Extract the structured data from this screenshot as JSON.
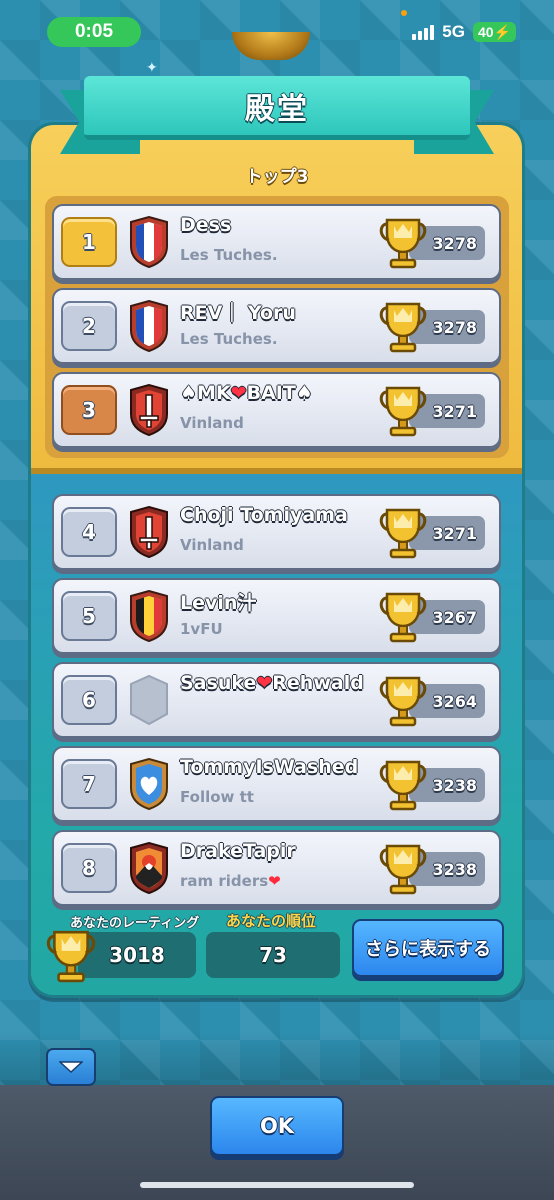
{
  "status_bar": {
    "time": "0:05",
    "network": "5G",
    "battery": "40"
  },
  "header": {
    "title": "殿堂",
    "subtitle": "トップ3"
  },
  "players": [
    {
      "rank": "1",
      "name": "Dess",
      "clan": "Les Tuches.",
      "trophies": "3278",
      "badge": "french-flag-badge-icon",
      "rank_style": "gold"
    },
    {
      "rank": "2",
      "name": "REV｜ Yoru",
      "clan": "Les Tuches.",
      "trophies": "3278",
      "badge": "french-flag-badge-icon",
      "rank_style": "silver"
    },
    {
      "rank": "3",
      "name_parts": [
        "♠MK",
        "❤",
        "BAIT♠"
      ],
      "clan": "Vinland",
      "trophies": "3271",
      "badge": "sword-badge-icon",
      "rank_style": "bronze"
    },
    {
      "rank": "4",
      "name": "Choji Tomiyama",
      "clan": "Vinland",
      "trophies": "3271",
      "badge": "sword-badge-icon",
      "rank_style": "plain"
    },
    {
      "rank": "5",
      "name": "Levin汁",
      "clan": "1vFU",
      "trophies": "3267",
      "badge": "belgian-flag-badge-icon",
      "rank_style": "plain"
    },
    {
      "rank": "6",
      "name_parts": [
        "Sasuke",
        "❤",
        "Rehwald"
      ],
      "clan": "",
      "trophies": "3264",
      "badge": "empty-badge-icon",
      "rank_style": "plain"
    },
    {
      "rank": "7",
      "name": "TommyIsWashed",
      "clan": "Follow tt",
      "trophies": "3238",
      "badge": "heart-badge-icon",
      "rank_style": "plain"
    },
    {
      "rank": "8",
      "name": "DrakeTapir",
      "clan_parts": [
        "ram riders",
        "❤"
      ],
      "trophies": "3238",
      "badge": "mountain-badge-icon",
      "rank_style": "plain"
    }
  ],
  "footer": {
    "your_rating_label": "あなたのレーティング",
    "your_rating": "3018",
    "your_rank_label": "あなたの順位",
    "your_rank": "73",
    "show_more_label": "さらに表示する"
  },
  "ok_label": "OK",
  "colors": {
    "gold_panel": "#f7cf5a",
    "teal_panel": "#2aa6b3",
    "button_blue": "#2d87ee",
    "status_green": "#35c759"
  }
}
